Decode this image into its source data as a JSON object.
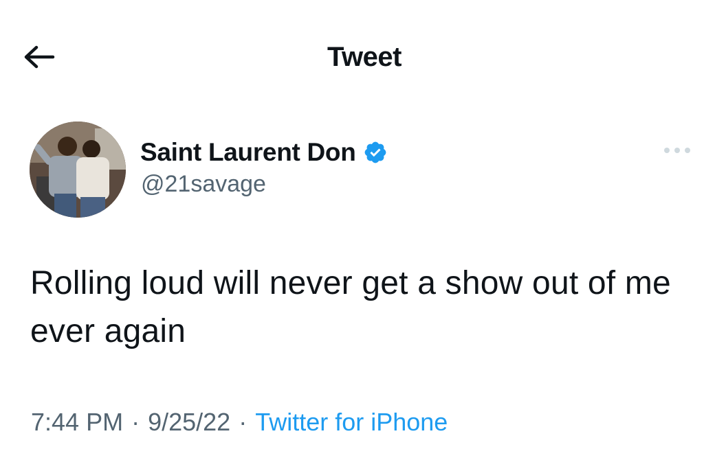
{
  "header": {
    "title": "Tweet",
    "back_icon": "arrow-left-icon"
  },
  "tweet": {
    "author": {
      "display_name": "Saint Laurent Don",
      "handle": "@21savage",
      "verified": true,
      "avatar_icon": "avatar-photo"
    },
    "more_icon": "more-horizontal-icon",
    "text": "Rolling loud will never get a show out of me ever again",
    "time": "7:44 PM",
    "separator": "·",
    "date": "9/25/22",
    "source": "Twitter for iPhone"
  },
  "colors": {
    "accent": "#1d9bf0",
    "secondary_text": "#536471",
    "primary_text": "#0f1419",
    "background": "#ffffff"
  }
}
